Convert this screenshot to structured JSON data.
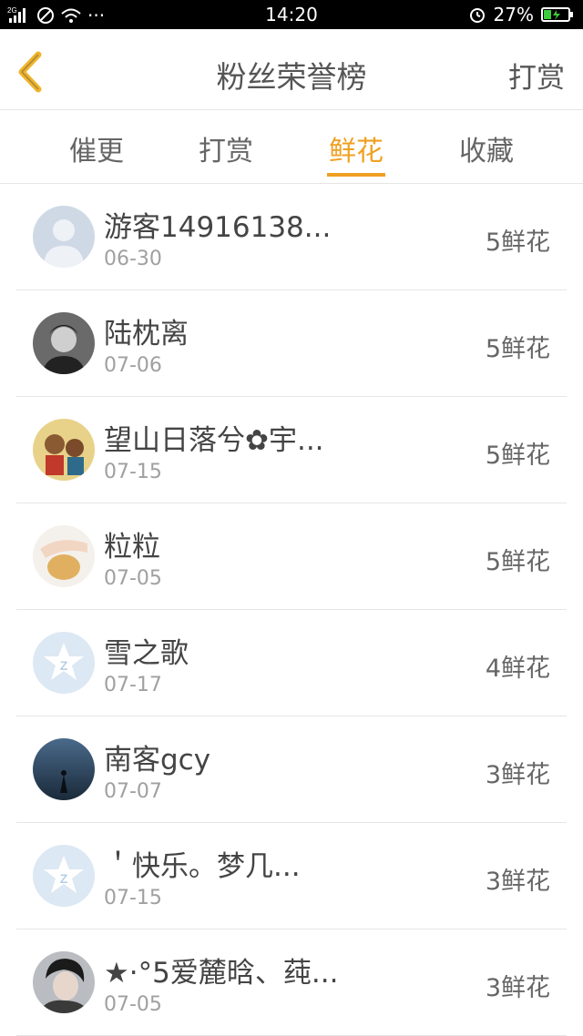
{
  "status_bar": {
    "network": "2G",
    "time": "14:20",
    "battery": "27%",
    "menu_dots": "···"
  },
  "header": {
    "title": "粉丝荣誉榜",
    "action_label": "打赏"
  },
  "tabs": [
    {
      "label": "催更",
      "active": false
    },
    {
      "label": "打赏",
      "active": false
    },
    {
      "label": "鲜花",
      "active": true
    },
    {
      "label": "收藏",
      "active": false
    }
  ],
  "list": [
    {
      "name": "游客14916138...",
      "date": "06-30",
      "count": "5鲜花",
      "avatar": "default-user"
    },
    {
      "name": "陆枕离",
      "date": "07-06",
      "count": "5鲜花",
      "avatar": "photo"
    },
    {
      "name": "望山日落兮✿宇...",
      "date": "07-15",
      "count": "5鲜花",
      "avatar": "photo"
    },
    {
      "name": "粒粒",
      "date": "07-05",
      "count": "5鲜花",
      "avatar": "photo"
    },
    {
      "name": "雪之歌",
      "date": "07-17",
      "count": "4鲜花",
      "avatar": "qq-default"
    },
    {
      "name": "南客gcy",
      "date": "07-07",
      "count": "3鲜花",
      "avatar": "photo"
    },
    {
      "name": "＇快乐。梦几...",
      "date": "07-15",
      "count": "3鲜花",
      "avatar": "qq-default"
    },
    {
      "name": "★·°5爱麓晗、莼...",
      "date": "07-05",
      "count": "3鲜花",
      "avatar": "photo"
    }
  ],
  "colors": {
    "accent": "#f0a020",
    "back_arrow": "#f0b428"
  }
}
